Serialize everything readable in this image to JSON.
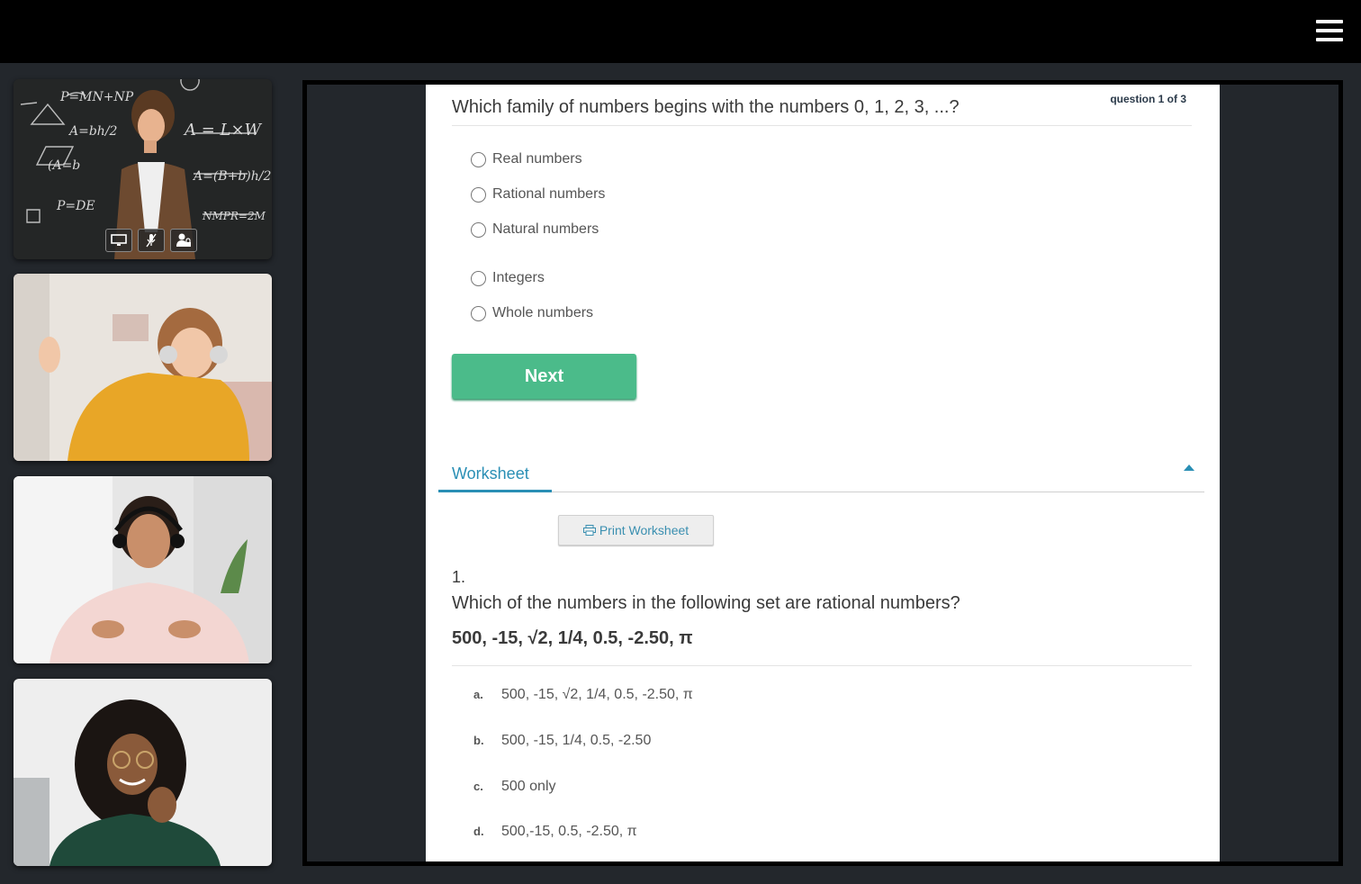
{
  "header": {
    "menu_icon": "hamburger-menu-icon"
  },
  "participants": [
    {
      "name": "teacher",
      "controls": [
        "screen-share-icon",
        "mic-muted-icon",
        "user-lock-icon"
      ]
    },
    {
      "name": "student-girl-headphones"
    },
    {
      "name": "student-woman-headset"
    },
    {
      "name": "student-woman-curly-hair"
    }
  ],
  "quiz": {
    "counter": "question 1 of 3",
    "question": "Which family of numbers begins with the numbers 0, 1, 2, 3, ...?",
    "options": [
      "Real numbers",
      "Rational numbers",
      "Natural numbers",
      "Integers",
      "Whole numbers"
    ],
    "next_label": "Next"
  },
  "worksheet": {
    "tab_label": "Worksheet",
    "print_label": "Print Worksheet",
    "question_number": "1.",
    "question": "Which of the numbers in the following set are rational numbers?",
    "set": "500, -15, √2, 1/4, 0.5, -2.50, π",
    "answers": [
      {
        "letter": "a.",
        "text": "500, -15, √2, 1/4, 0.5, -2.50, π"
      },
      {
        "letter": "b.",
        "text": "500, -15, 1/4, 0.5, -2.50"
      },
      {
        "letter": "c.",
        "text": "500 only"
      },
      {
        "letter": "d.",
        "text": "500,-15, 0.5, -2.50, π"
      }
    ]
  },
  "colors": {
    "accent_green": "#4bbb8a",
    "accent_blue": "#2a8fb5",
    "background": "#23272c"
  }
}
